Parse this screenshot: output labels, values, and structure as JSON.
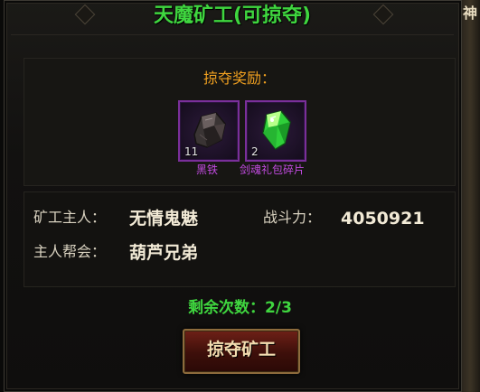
{
  "window": {
    "title": "天魔矿工(可掠夺)",
    "right_edge_char": "神"
  },
  "reward": {
    "title": "掠夺奖励：",
    "items": [
      {
        "name": "黑铁",
        "count": "11",
        "icon": "black-iron-ore-icon"
      },
      {
        "name": "剑魂礼包碎片",
        "count": "2",
        "icon": "green-crystal-shard-icon"
      }
    ]
  },
  "info": {
    "owner_label": "矿工主人：",
    "owner_value": "无情鬼魅",
    "power_label": "战斗力：",
    "power_value": "4050921",
    "guild_label": "主人帮会：",
    "guild_value": "葫芦兄弟"
  },
  "remaining": "剩余次数：2/3",
  "button": {
    "label": "掠夺矿工"
  },
  "colors": {
    "title": "#3fd63f",
    "reward_title": "#f0a020",
    "item_name": "#c24be0",
    "remaining": "#3fd63f"
  }
}
